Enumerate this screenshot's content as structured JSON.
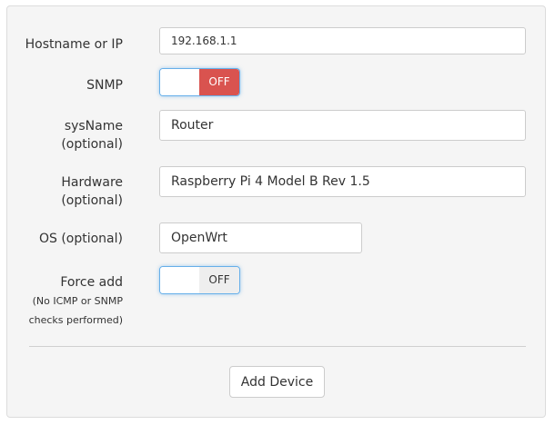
{
  "form": {
    "hostname": {
      "label": "Hostname or IP",
      "value": "192.168.1.1"
    },
    "snmp": {
      "label": "SNMP",
      "state": "OFF"
    },
    "sysname": {
      "label_line1": "sysName",
      "label_line2": "(optional)",
      "value": "Router"
    },
    "hardware": {
      "label_line1": "Hardware",
      "label_line2": "(optional)",
      "value": "Raspberry Pi 4 Model B Rev 1.5"
    },
    "os": {
      "label": "OS (optional)",
      "value": "OpenWrt"
    },
    "force_add": {
      "label": "Force add",
      "note_line1": "(No ICMP or SNMP",
      "note_line2": "checks performed)",
      "state": "OFF"
    },
    "submit_label": "Add Device"
  },
  "colors": {
    "panel_bg": "#f5f5f5",
    "toggle_off_red": "#d9534f",
    "toggle_off_grey": "#eeeeee",
    "focus_border": "#66afe9"
  }
}
